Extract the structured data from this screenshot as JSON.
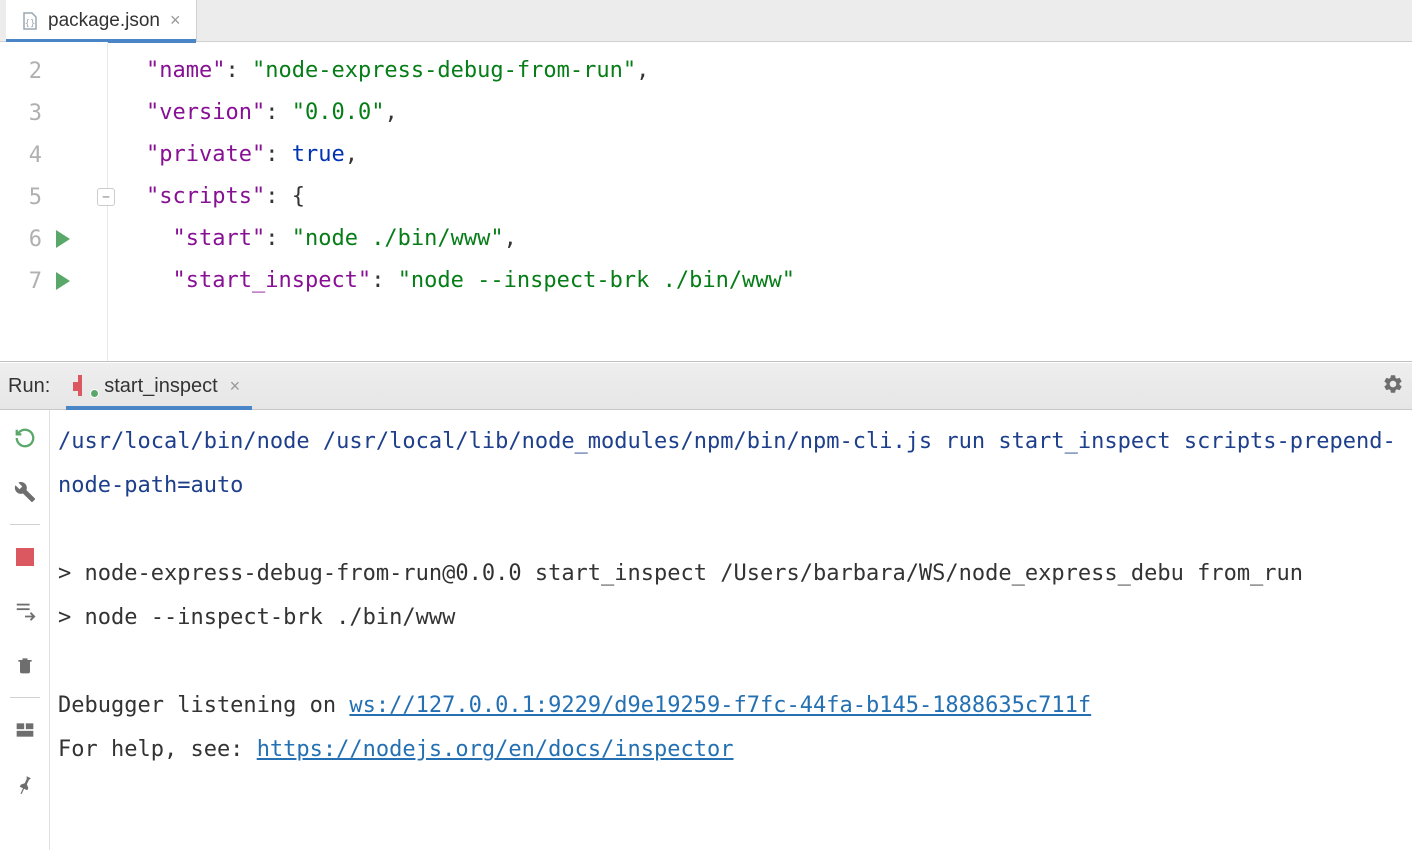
{
  "editor": {
    "tab": {
      "filename": "package.json",
      "close_glyph": "×"
    },
    "lines": [
      {
        "num": "2",
        "run": false,
        "fold": false
      },
      {
        "num": "3",
        "run": false,
        "fold": false
      },
      {
        "num": "4",
        "run": false,
        "fold": false
      },
      {
        "num": "5",
        "run": false,
        "fold": true
      },
      {
        "num": "6",
        "run": true,
        "fold": false
      },
      {
        "num": "7",
        "run": true,
        "fold": false
      }
    ],
    "code": {
      "l2": {
        "key": "\"name\"",
        "val": "\"node-express-debug-from-run\""
      },
      "l3": {
        "key": "\"version\"",
        "val": "\"0.0.0\""
      },
      "l4": {
        "key": "\"private\"",
        "val": "true"
      },
      "l5": {
        "key": "\"scripts\"",
        "brace": "{"
      },
      "l6": {
        "key": "\"start\"",
        "val": "\"node ./bin/www\""
      },
      "l7": {
        "key": "\"start_inspect\"",
        "val": "\"node --inspect-brk ./bin/www\""
      }
    }
  },
  "run": {
    "header_label": "Run:",
    "tab_label": "start_inspect",
    "tab_close": "×",
    "console": {
      "cmd_line": "/usr/local/bin/node /usr/local/lib/node_modules/npm/bin/npm-cli.js run start_inspect scripts-prepend-node-path=auto",
      "block1_l1": "> node-express-debug-from-run@0.0.0 start_inspect /Users/barbara/WS/node_express_debu from_run",
      "block1_l2": "> node --inspect-brk ./bin/www",
      "dbg_prefix": "Debugger listening on ",
      "dbg_link": "ws://127.0.0.1:9229/d9e19259-f7fc-44fa-b145-1888635c711f",
      "help_prefix": "For help, see: ",
      "help_link": "https://nodejs.org/en/docs/inspector"
    }
  }
}
